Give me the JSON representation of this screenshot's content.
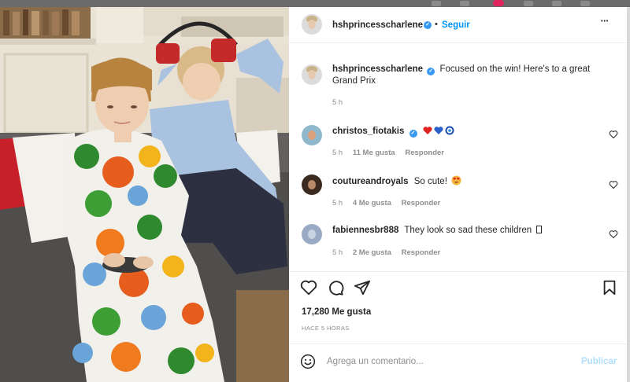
{
  "post": {
    "author": "hshprincesscharlene",
    "follow_label": "Seguir",
    "separator": "•",
    "more_label": "•••",
    "caption": "Focused on the win! Here's to a great Grand Prix",
    "caption_age": "5 h",
    "likes_label": "17,280 Me gusta",
    "posted": "HACE 5 HORAS"
  },
  "comments": [
    {
      "user": "christos_fiotakis",
      "verified": true,
      "text": "",
      "age": "5 h",
      "likes": "11 Me gusta",
      "reply": "Responder"
    },
    {
      "user": "coutureandroyals",
      "verified": false,
      "text": "So cute!",
      "age": "5 h",
      "likes": "4 Me gusta",
      "reply": "Responder"
    },
    {
      "user": "fabiennesbr888",
      "verified": false,
      "text": "They look so sad these children",
      "age": "5 h",
      "likes": "2 Me gusta",
      "reply": "Responder"
    }
  ],
  "composer": {
    "placeholder": "Agrega un comentario...",
    "publish_label": "Publicar"
  },
  "icons": {
    "post": [
      "verified-badge-icon",
      "more-options-icon"
    ],
    "actions": [
      "heart-icon",
      "comment-icon",
      "share-icon",
      "bookmark-icon"
    ],
    "comment_like": "heart-outline-icon",
    "emoji": "emoji-icon",
    "comment1_emojis": [
      "red-heart-emoji",
      "blue-heart-emoji",
      "nazar-amulet-emoji"
    ],
    "comment2_emoji": "heart-eyes-emoji"
  },
  "colors": {
    "link_blue": "#0095f6",
    "publish_disabled": "#b2dffc",
    "muted_text": "#8e8e8e",
    "verified_blue": "#3897f0"
  }
}
